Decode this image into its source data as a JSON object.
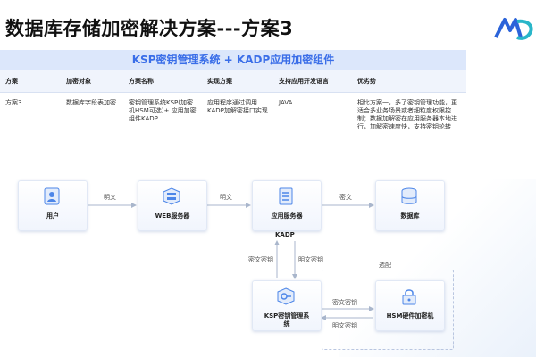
{
  "header": {
    "title": "数据库存储加密解决方案---方案3",
    "logo_icon": "brand-logo-icon"
  },
  "banner": {
    "text": "KSP密钥管理系统 + KADP应用加密组件"
  },
  "table": {
    "columns": [
      "方案",
      "加密对象",
      "方案名称",
      "实现方案",
      "支持应用开发语言",
      "优劣势"
    ],
    "row": {
      "plan": "方案3",
      "target": "数据库字段表加密",
      "name": "密钥管理系统KSP(加密机HSM可选)+ 应用加密组件KADP",
      "implementation": "应用程序通过调用KADP加解密接口实现",
      "language": "JAVA",
      "pros_cons": "相比方案一，多了密钥管理功能，更适合多业务场景或者细粒度权限控制；数据加解密在应用服务器本地进行，加解密速度快，支持密钥轮转"
    }
  },
  "diagram": {
    "nodes": {
      "user": {
        "label": "用户",
        "icon": "user-icon"
      },
      "web": {
        "label": "WEB服务器",
        "icon": "server-icon"
      },
      "app": {
        "label": "应用服务器",
        "icon": "server-icon"
      },
      "db": {
        "label": "数据库",
        "icon": "database-icon"
      },
      "ksp": {
        "label": "KSP密钥管理系统",
        "icon": "key-management-icon"
      },
      "hsm": {
        "label": "HSM硬件加密机",
        "icon": "lock-icon"
      }
    },
    "kadp_label": "KADP",
    "edges": {
      "user_web": "明文",
      "web_app": "明文",
      "app_db": "密文",
      "ksp_to_app": "密文密钥",
      "app_to_ksp": "明文密钥",
      "ksp_to_hsm": "密文密钥",
      "hsm_to_ksp": "明文密钥",
      "optional": "选配"
    },
    "colors": {
      "accent": "#3a6ee8",
      "node_icon": "#4d86e8",
      "line": "#a9b6cc"
    }
  }
}
